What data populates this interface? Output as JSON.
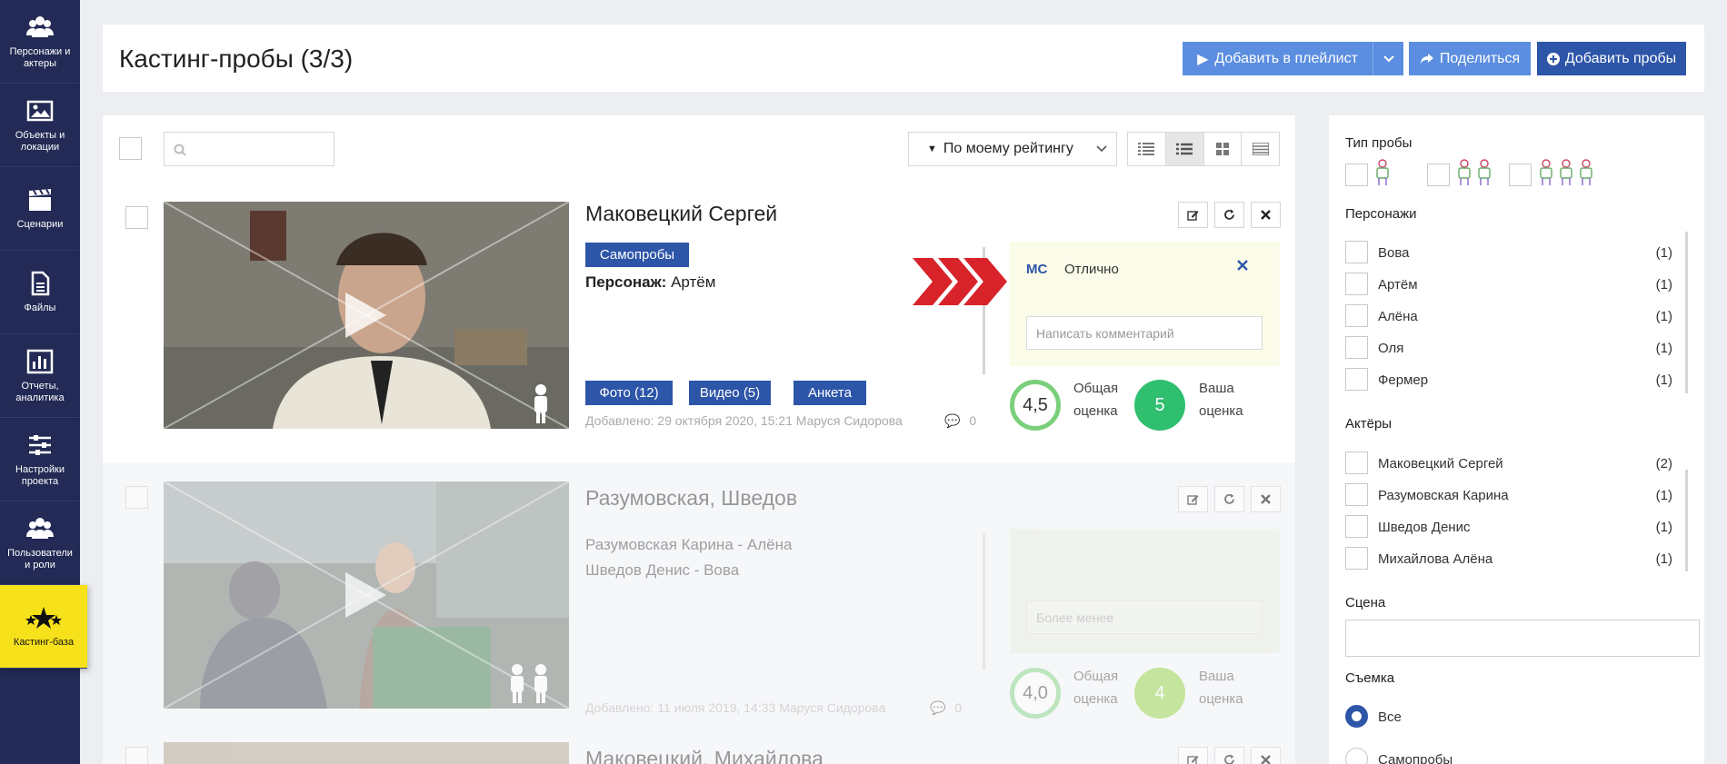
{
  "sidebar": {
    "items": [
      {
        "label": "Персонажи и актеры",
        "icon": "users-icon"
      },
      {
        "label": "Объекты и локации",
        "icon": "image-icon"
      },
      {
        "label": "Сценарии",
        "icon": "clapperboard-icon"
      },
      {
        "label": "Файлы",
        "icon": "file-icon"
      },
      {
        "label": "Отчеты, аналитика",
        "icon": "chart-icon"
      },
      {
        "label": "Настройки проекта",
        "icon": "sliders-icon"
      },
      {
        "label": "Пользователи и роли",
        "icon": "users-icon"
      },
      {
        "label": "Кастинг-база",
        "icon": "stars-icon"
      }
    ]
  },
  "header": {
    "title": "Кастинг-пробы (3/3)",
    "add_playlist": "Добавить в плейлист",
    "share": "Поделиться",
    "add_tests": "Добавить пробы"
  },
  "toolbar": {
    "search_placeholder": "",
    "sort_label": "По моему рейтингу"
  },
  "cards": [
    {
      "title": "Маковецкий Сергей",
      "tag": "Самопробы",
      "character_label": "Персонаж:",
      "character": "Артём",
      "buttons": [
        "Фото (12)",
        "Видео (5)",
        "Анкета"
      ],
      "added": "Добавлено: 29 октября 2020, 15:21  Маруся Сидорова",
      "comments": "0",
      "review": {
        "initials": "МС",
        "text": "Отлично",
        "placeholder": "Написать комментарий"
      },
      "total_score": "4,5",
      "total_label1": "Общая",
      "total_label2": "оценка",
      "my_score": "5",
      "my_label1": "Ваша",
      "my_label2": "оценка"
    },
    {
      "title": "Разумовская, Шведов",
      "lines": [
        "Разумовская Карина - Алёна",
        "Шведов Денис - Вова"
      ],
      "added": "Добавлено: 11 июля 2019, 14:33  Маруся Сидорова",
      "comments": "0",
      "review": {
        "placeholder": "Более менее"
      },
      "total_score": "4,0",
      "total_label1": "Общая",
      "total_label2": "оценка",
      "my_score": "4",
      "my_label1": "Ваша",
      "my_label2": "оценка"
    },
    {
      "title": "Маковецкий, Михайлова"
    }
  ],
  "filters": {
    "test_type_heading": "Тип пробы",
    "characters_heading": "Персонажи",
    "characters": [
      {
        "name": "Вова",
        "count": "(1)"
      },
      {
        "name": "Артём",
        "count": "(1)"
      },
      {
        "name": "Алёна",
        "count": "(1)"
      },
      {
        "name": "Оля",
        "count": "(1)"
      },
      {
        "name": "Фермер",
        "count": "(1)"
      }
    ],
    "actors_heading": "Актёры",
    "actors": [
      {
        "name": "Маковецкий Сергей",
        "count": "(2)"
      },
      {
        "name": "Разумовская Карина",
        "count": "(1)"
      },
      {
        "name": "Шведов Денис",
        "count": "(1)"
      },
      {
        "name": "Михайлова Алёна",
        "count": "(1)"
      }
    ],
    "scene_heading": "Сцена",
    "shooting_heading": "Съемка",
    "shooting_options": [
      "Все",
      "Самопробы"
    ]
  },
  "colors": {
    "sidebar": "#222a55",
    "accent": "#2d55a8",
    "accent_light": "#5b8ee0",
    "active": "#f7e11a",
    "score_green": "#2fbf6f"
  }
}
